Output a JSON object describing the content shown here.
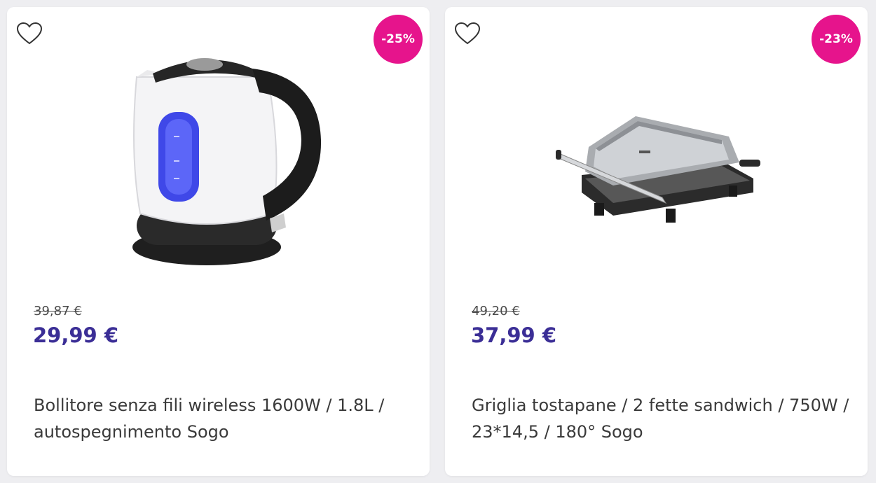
{
  "products": [
    {
      "discount": "-25%",
      "old_price": "39,87 €",
      "price": "29,99 €",
      "title": "Bollitore senza fili wireless 1600W / 1.8L / autospegnimento Sogo",
      "image": "electric-kettle-icon"
    },
    {
      "discount": "-23%",
      "old_price": "49,20 €",
      "price": "37,99 €",
      "title": "Griglia tostapane / 2 fette sandwich / 750W / 23*14,5 / 180° Sogo",
      "image": "sandwich-grill-icon"
    }
  ],
  "colors": {
    "badge": "#e6148c",
    "price": "#3b2e96",
    "background": "#eeeef1",
    "card": "#ffffff"
  }
}
